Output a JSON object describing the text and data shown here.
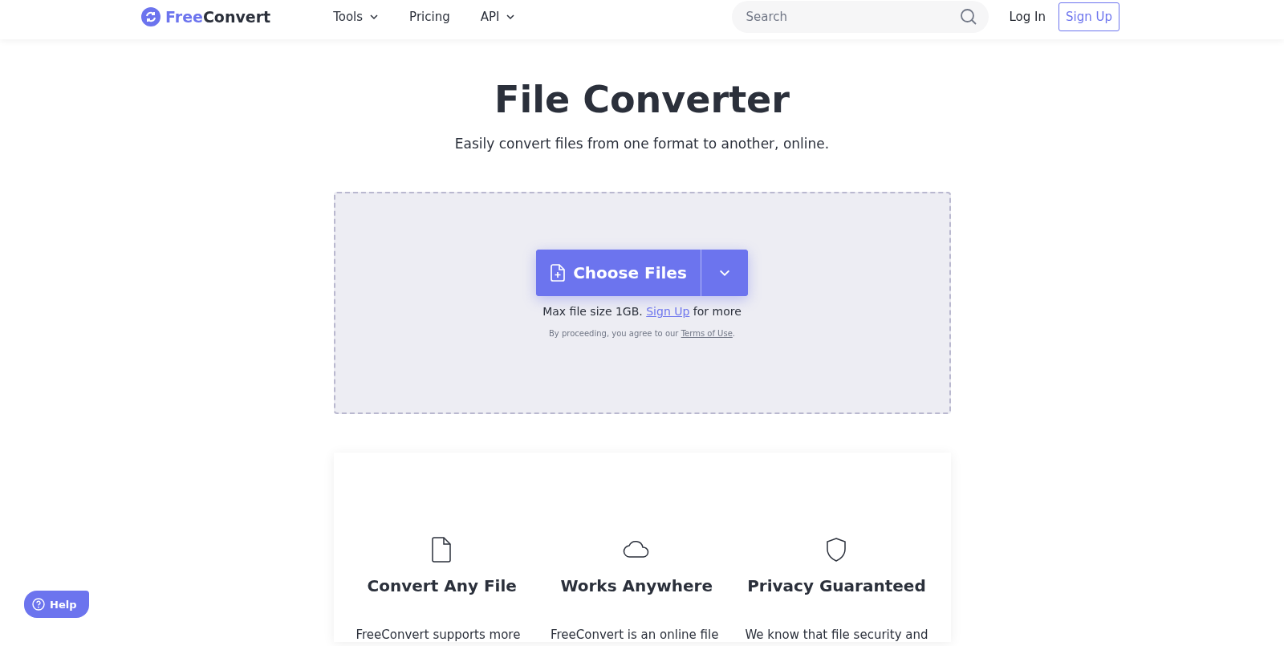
{
  "header": {
    "logo": {
      "prefix": "Free",
      "suffix": "Convert"
    },
    "nav": [
      {
        "label": "Tools",
        "dropdown": true
      },
      {
        "label": "Pricing",
        "dropdown": false
      },
      {
        "label": "API",
        "dropdown": true
      }
    ],
    "search": {
      "placeholder": "Search"
    },
    "login": "Log In",
    "signup": "Sign Up"
  },
  "hero": {
    "title": "File Converter",
    "subtitle": "Easily convert files from one format to another, online."
  },
  "upload": {
    "button": "Choose Files",
    "limit_before": "Max file size 1GB.",
    "limit_link": "Sign Up",
    "limit_after": "for more",
    "terms_before": "By proceeding, you agree to our",
    "terms_link": "Terms of Use",
    "terms_after": "."
  },
  "features": [
    {
      "kind": "file",
      "title": "Convert Any File",
      "text": "FreeConvert supports more"
    },
    {
      "kind": "cloud",
      "title": "Works Anywhere",
      "text": "FreeConvert is an online file"
    },
    {
      "kind": "shield",
      "title": "Privacy Guaranteed",
      "text": "We know that file security and"
    }
  ],
  "help": {
    "label": "Help"
  }
}
